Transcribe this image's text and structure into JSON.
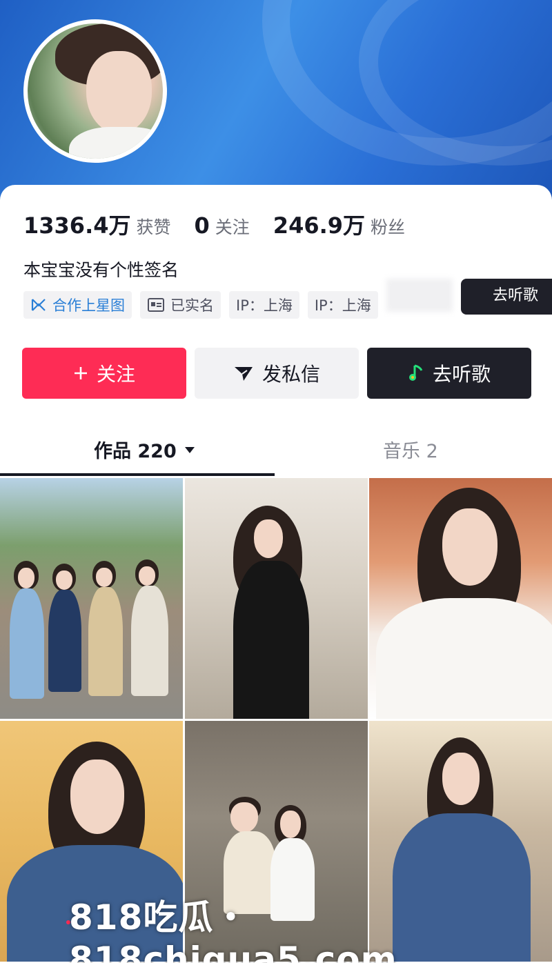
{
  "profile": {
    "stats": [
      {
        "value": "1336.4万",
        "label": "获赞"
      },
      {
        "value": "0",
        "label": "关注"
      },
      {
        "value": "246.9万",
        "label": "粉丝"
      }
    ],
    "signature": "本宝宝没有个性签名",
    "tags": [
      {
        "label": "合作上星图",
        "icon": "star-map-icon"
      },
      {
        "label": "已实名",
        "icon": "id-card-icon"
      },
      {
        "label": "IP：上海"
      },
      {
        "label": "IP：上海"
      }
    ],
    "floating_button_label": "去听歌"
  },
  "actions": {
    "follow_label": "关注",
    "message_label": "发私信",
    "music_label": "去听歌"
  },
  "tabs": [
    {
      "label": "作品 220"
    },
    {
      "label": "音乐 2"
    }
  ],
  "watermark": "818吃瓜・818chigua5.com",
  "colors": {
    "follow": "#fe2c55",
    "dark_button": "#1f2029",
    "header_blue": "#2a6fd6"
  }
}
